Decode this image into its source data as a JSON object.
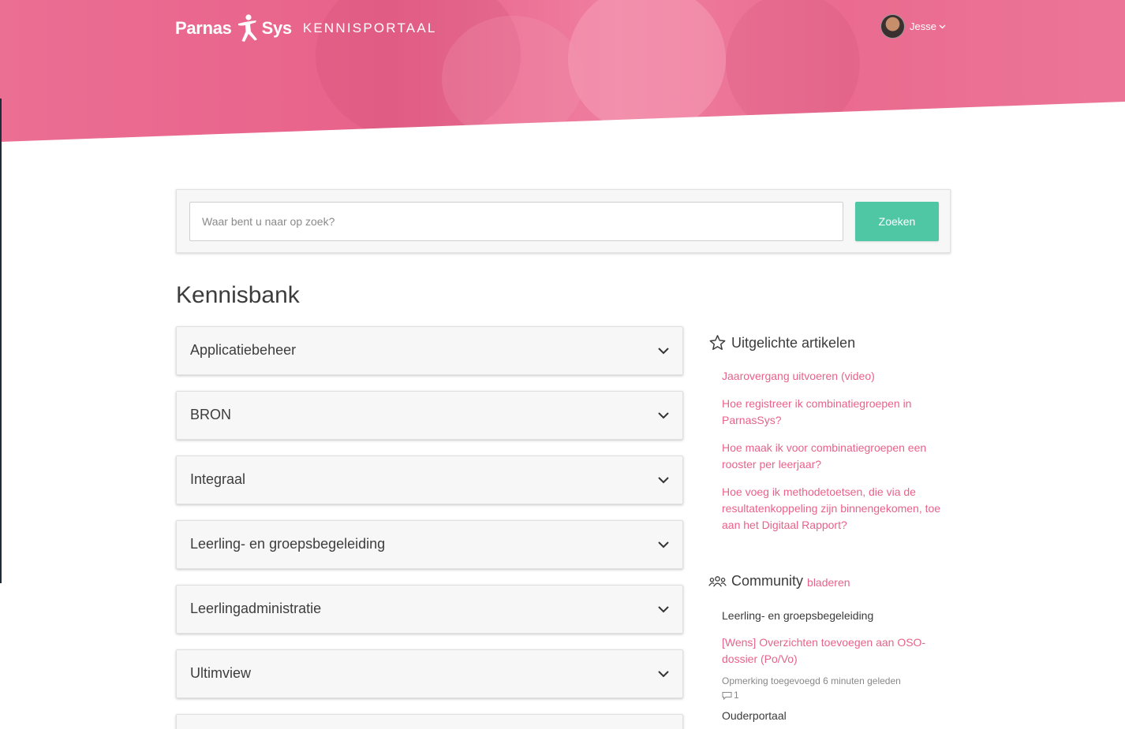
{
  "header": {
    "logo_left": "Parnas",
    "logo_right": "Sys",
    "portal_title": "KENNISPORTAAL",
    "user_name": "Jesse",
    "chevron": "⌄"
  },
  "search": {
    "placeholder": "Waar bent u naar op zoek?",
    "button_label": "Zoeken"
  },
  "main": {
    "title": "Kennisbank",
    "categories": [
      "Applicatiebeheer",
      "BRON",
      "Integraal",
      "Leerling- en groepsbegeleiding",
      "Leerlingadministratie",
      "Ultimview"
    ]
  },
  "featured": {
    "title": "Uitgelichte artikelen",
    "articles": [
      "Jaarovergang uitvoeren (video)",
      "Hoe registreer ik combinatiegroepen in ParnasSys?",
      "Hoe maak ik voor combinatiegroepen een rooster per leerjaar?",
      "Hoe voeg ik methodetoetsen, die via de resultatenkoppeling zijn binnengekomen, toe aan het Digitaal Rapport?"
    ]
  },
  "community": {
    "title": "Community",
    "browse_label": "bladeren",
    "posts": [
      {
        "category": "Leerling- en groepsbegeleiding",
        "title": "[Wens] Overzichten toevoegen aan OSO-dossier (Po/Vo)",
        "meta": "Opmerking toegevoegd 6 minuten geleden",
        "comments": "1"
      }
    ],
    "next_category": "Ouderportaal"
  },
  "colors": {
    "brand_pink": "#e8628a",
    "search_button": "#4fc6a4"
  },
  "icons": [
    "star-icon",
    "community-icon",
    "chevron-down-icon",
    "comment-icon",
    "user-avatar"
  ]
}
